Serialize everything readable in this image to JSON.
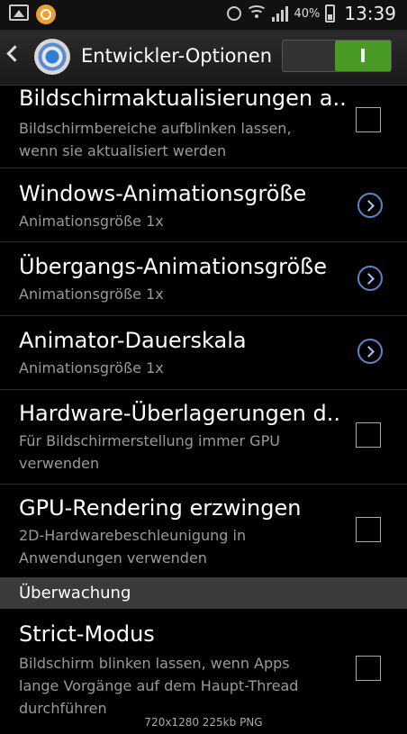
{
  "status_bar": {
    "battery": "40%",
    "time": "13:39"
  },
  "action_bar": {
    "title": "Entwickler-Optionen",
    "toggle_label": "I"
  },
  "items": [
    {
      "title": "Bildschirmaktualisierungen a..",
      "sub": [
        "Bildschirmbereiche aufblinken lassen,",
        "wenn sie aktualisiert werden"
      ]
    },
    {
      "title": "Windows-Animationsgröße",
      "sub": [
        "Animationsgröße 1x"
      ]
    },
    {
      "title": "Übergangs-Animationsgröße",
      "sub": [
        "Animationsgröße 1x"
      ]
    },
    {
      "title": "Animator-Dauerskala",
      "sub": [
        "Animationsgröße 1x"
      ]
    },
    {
      "title": "Hardware-Überlagerungen d..",
      "sub": [
        "Für Bildschirmerstellung immer GPU",
        "verwenden"
      ]
    },
    {
      "title": "GPU-Rendering erzwingen",
      "sub": [
        "2D-Hardwarebeschleunigung in",
        "Anwendungen verwenden"
      ]
    }
  ],
  "section": {
    "label": "Überwachung"
  },
  "strict": {
    "title": "Strict-Modus",
    "sub": [
      "Bildschirm blinken lassen, wenn Apps",
      "lange Vorgänge auf dem Haupt-Thread",
      "durchführen"
    ]
  },
  "caption": "720x1280 225kb PNG"
}
